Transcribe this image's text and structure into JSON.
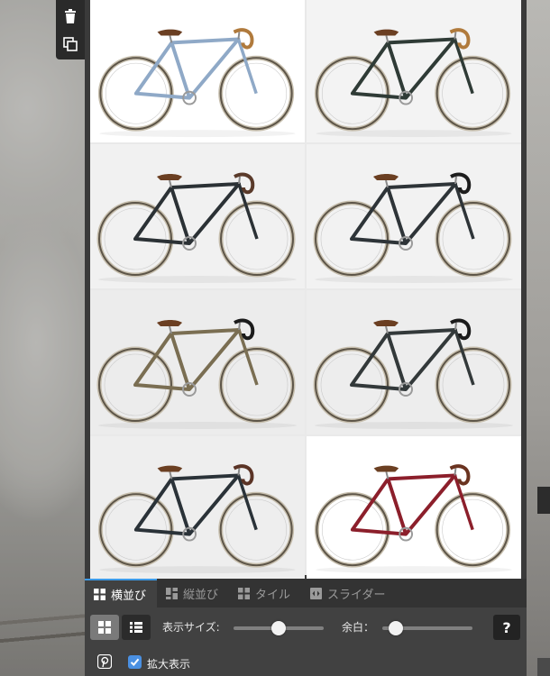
{
  "toolbar": {
    "delete_icon": "trash-icon",
    "duplicate_icon": "duplicate-icon"
  },
  "gallery": {
    "images": [
      {
        "frame_color": "#8fa9c7",
        "bar_color": "#b07a3c",
        "bg": "#ffffff"
      },
      {
        "frame_color": "#2f3b36",
        "bar_color": "#b07a3c",
        "bg": "#f3f3f3"
      },
      {
        "frame_color": "#2b3135",
        "bar_color": "#5a3a2a",
        "bg": "#f1f1f1"
      },
      {
        "frame_color": "#2e3438",
        "bar_color": "#1e1e1e",
        "bg": "#f2f2f2"
      },
      {
        "frame_color": "#7a6e52",
        "bar_color": "#1b1b1b",
        "bg": "#ececec"
      },
      {
        "frame_color": "#33393a",
        "bar_color": "#1b1b1b",
        "bg": "#ededed"
      },
      {
        "frame_color": "#2a3238",
        "bar_color": "#5a3325",
        "bg": "#eeeeee"
      },
      {
        "frame_color": "#8c1f2b",
        "bar_color": "#6a3320",
        "bg": "#ffffff"
      }
    ]
  },
  "tabs": [
    {
      "label": "横並び",
      "icon": "grid-icon",
      "active": true
    },
    {
      "label": "縦並び",
      "icon": "masonry-icon",
      "active": false
    },
    {
      "label": "タイル",
      "icon": "tile-icon",
      "active": false
    },
    {
      "label": "スライダー",
      "icon": "slider-icon",
      "active": false
    }
  ],
  "controls": {
    "display_size_label": "表示サイズ:",
    "display_size_value": 0.5,
    "margin_label": "余白：",
    "margin_value": 0.15,
    "help_label": "?"
  },
  "options": {
    "pinterest_icon": "pinterest-icon",
    "zoom_label": "拡大表示",
    "zoom_checked": true
  },
  "colors": {
    "accent": "#3d9be9",
    "panel": "#414141",
    "checkbox": "#4a90e2"
  }
}
